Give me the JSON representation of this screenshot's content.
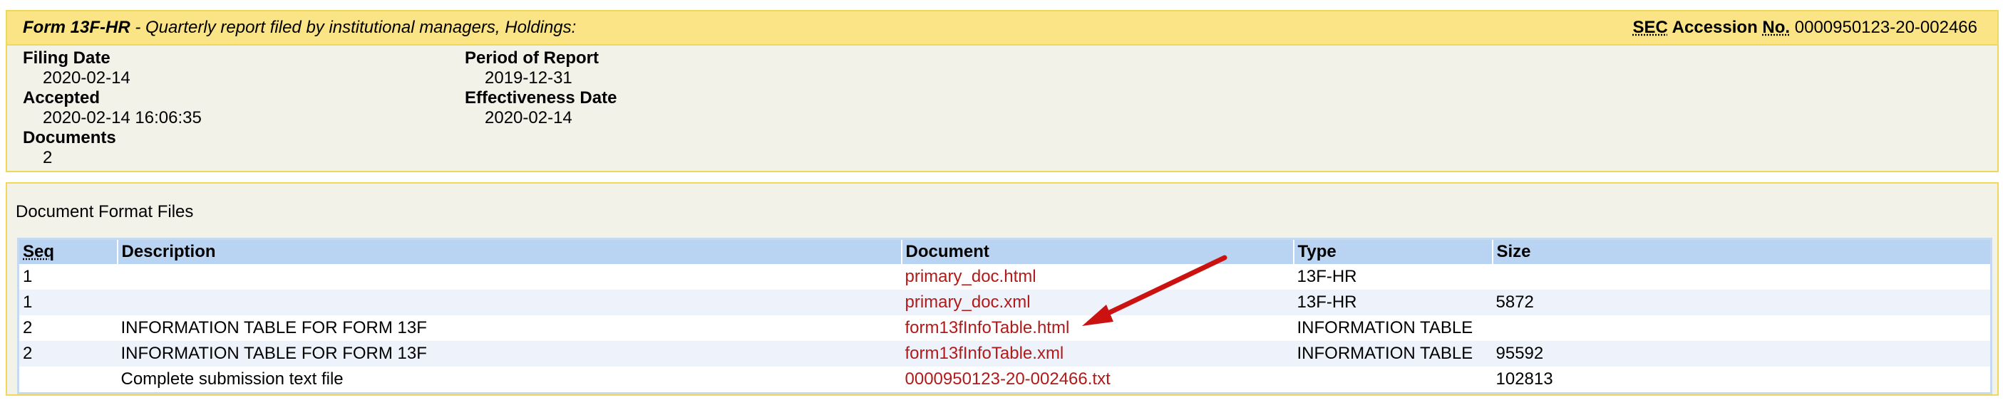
{
  "header": {
    "form_name": "Form 13F-HR",
    "form_description": " - Quarterly report filed by institutional managers, Holdings:",
    "accession_label_sec": "SEC",
    "accession_label_mid": " Accession ",
    "accession_label_no": "No.",
    "accession_number": "0000950123-20-002466"
  },
  "info": {
    "filing_date_label": "Filing Date",
    "filing_date": "2020-02-14",
    "accepted_label": "Accepted",
    "accepted": "2020-02-14 16:06:35",
    "documents_label": "Documents",
    "documents": "2",
    "period_label": "Period of Report",
    "period": "2019-12-31",
    "effectiveness_label": "Effectiveness Date",
    "effectiveness": "2020-02-14"
  },
  "files": {
    "heading": "Document Format Files",
    "columns": {
      "seq": "Seq",
      "description": "Description",
      "document": "Document",
      "type": "Type",
      "size": "Size"
    },
    "rows": [
      {
        "seq": "1",
        "description": "",
        "document": "primary_doc.html",
        "type": "13F-HR",
        "size": ""
      },
      {
        "seq": "1",
        "description": "",
        "document": "primary_doc.xml",
        "type": "13F-HR",
        "size": "5872"
      },
      {
        "seq": "2",
        "description": "INFORMATION TABLE FOR FORM 13F",
        "document": "form13fInfoTable.html",
        "type": "INFORMATION TABLE",
        "size": ""
      },
      {
        "seq": "2",
        "description": "INFORMATION TABLE FOR FORM 13F",
        "document": "form13fInfoTable.xml",
        "type": "INFORMATION TABLE",
        "size": "95592"
      },
      {
        "seq": "",
        "description": "Complete submission text file",
        "document": "0000950123-20-002466.txt",
        "type": "",
        "size": "102813"
      }
    ]
  },
  "colors": {
    "header_bar": "#fbe486",
    "panel_bg": "#f3f2e8",
    "panel_border": "#f0d85a",
    "table_header": "#b9d3f3",
    "link": "#b01a1a",
    "arrow": "#cc1111"
  },
  "icons": {
    "annotation": "red-arrow-icon"
  }
}
